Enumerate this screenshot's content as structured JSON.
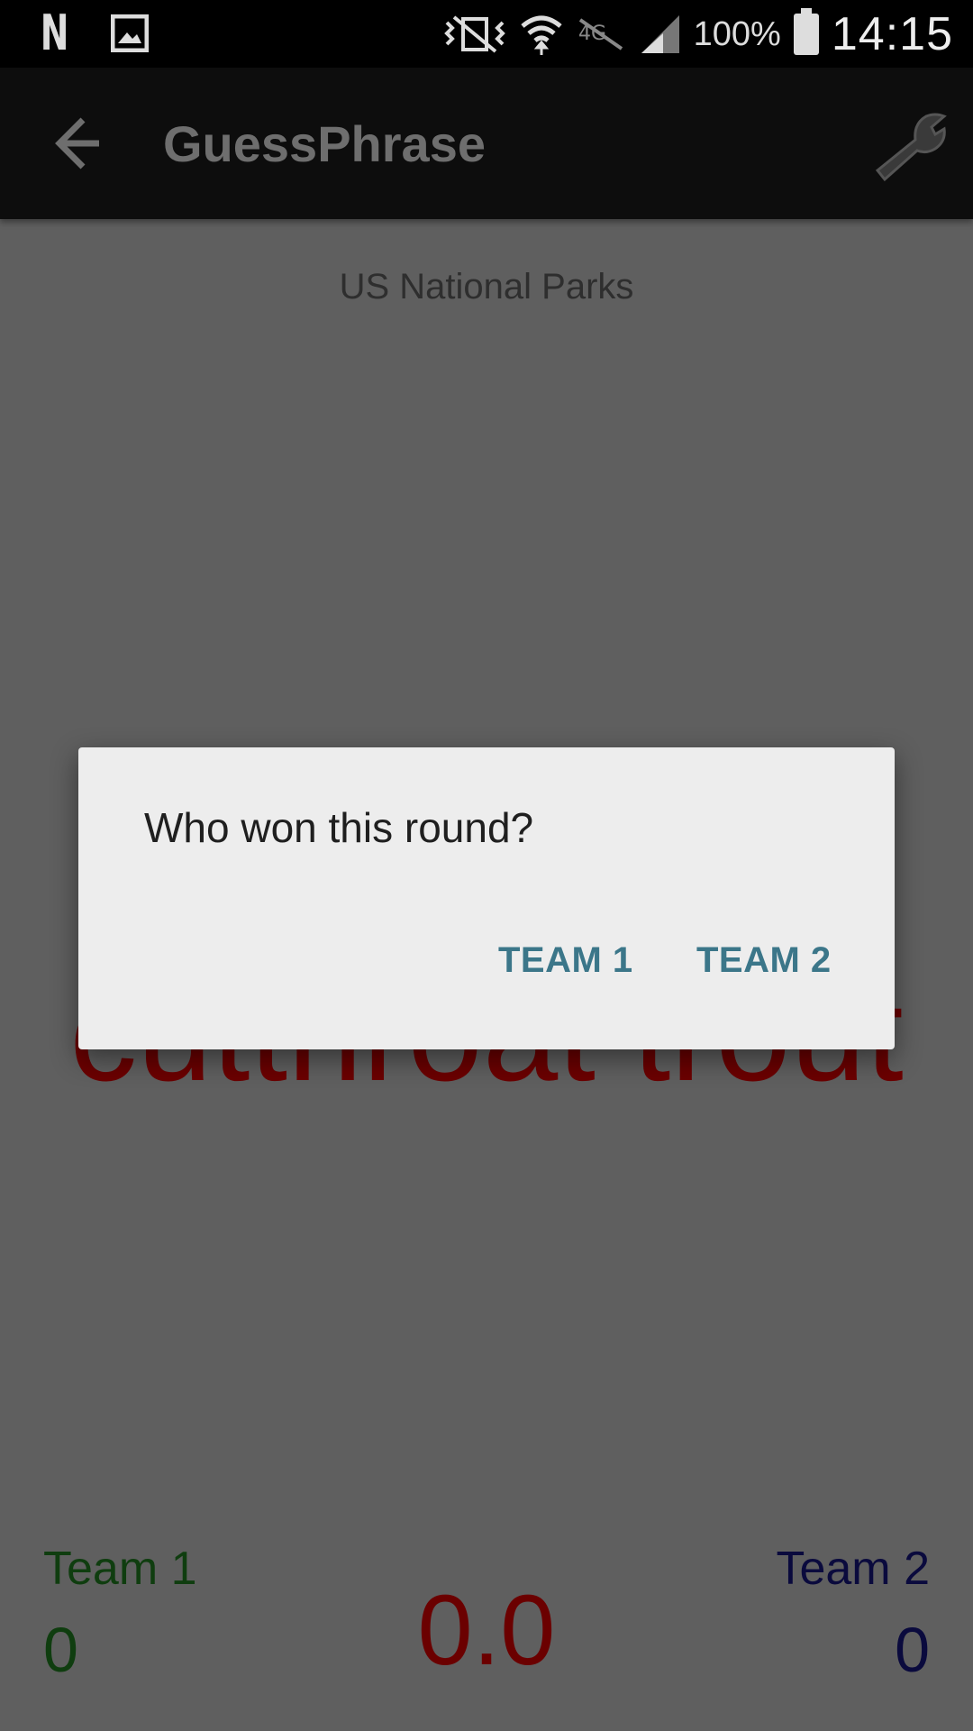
{
  "status_bar": {
    "battery_percent": "100%",
    "time": "14:15",
    "icons": [
      "netflix-icon",
      "gallery-icon",
      "vibrate-icon",
      "wifi-icon",
      "lte-icon",
      "signal-icon",
      "battery-icon"
    ]
  },
  "app_bar": {
    "title": "GuessPhrase"
  },
  "game": {
    "category": "US National Parks",
    "phrase": "cutthroat trout",
    "timer": "0.0"
  },
  "teams": {
    "team1": {
      "label": "Team 1",
      "score": "0",
      "color": "#0f3d0f"
    },
    "team2": {
      "label": "Team 2",
      "score": "0",
      "color": "#0a0a3d"
    }
  },
  "dialog": {
    "title": "Who won this round?",
    "buttons": {
      "team1": "TEAM 1",
      "team2": "TEAM 2"
    }
  },
  "colors": {
    "accent": "#3b7689",
    "phrase": "#6b0000",
    "scrim": "#5f5f5f"
  }
}
